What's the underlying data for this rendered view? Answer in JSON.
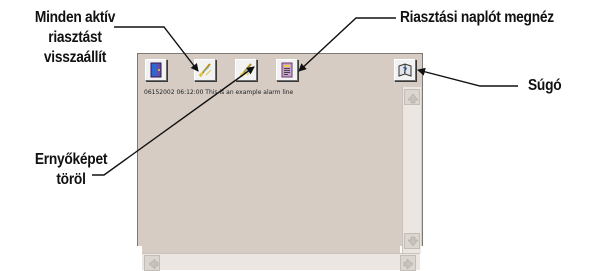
{
  "callouts": {
    "reset_all": [
      "Minden aktív",
      "riasztást",
      "visszaállít"
    ],
    "view_log": "Riasztási naplót megnéz",
    "help": "Súgó",
    "clear_screen": [
      "Ernyőképet",
      "töröl"
    ]
  },
  "alarm_list": {
    "lines": [
      "06152002 06:12:00 This is an example alarm line"
    ]
  },
  "toolbar": {
    "buttons": [
      {
        "name": "exit-button",
        "icon": "door-icon"
      },
      {
        "name": "reset-all-button",
        "icon": "broom-icon"
      },
      {
        "name": "clear-screen-button",
        "icon": "broom-icon"
      },
      {
        "name": "view-log-button",
        "icon": "log-document-icon"
      },
      {
        "name": "help-button",
        "icon": "help-book-icon"
      }
    ]
  },
  "colors": {
    "panel_bg": "#d6ccc4",
    "scrollbar_bg": "#ebe6e1",
    "door": "#6a4aa8",
    "log_doc": "#c8a0d0"
  }
}
